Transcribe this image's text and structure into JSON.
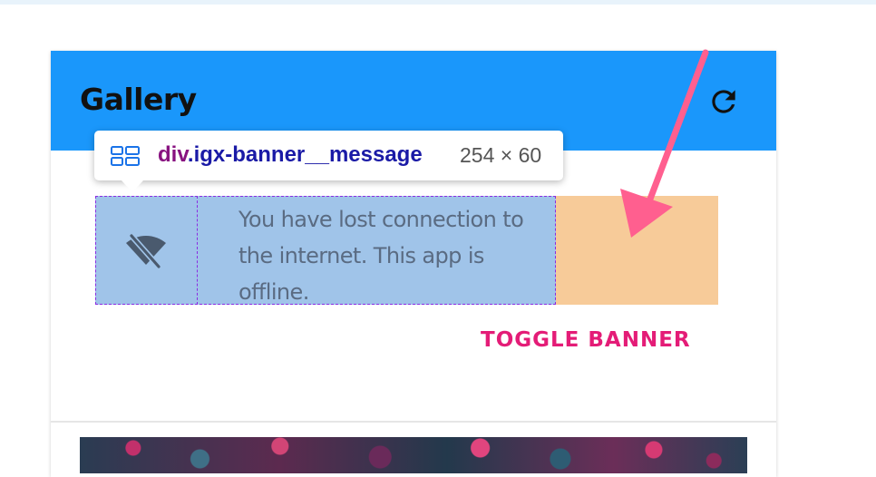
{
  "card": {
    "title": "Gallery",
    "refresh_icon": "refresh-icon",
    "header_color": "#1a97fb"
  },
  "banner": {
    "icon": "wifi-off-icon",
    "message": "You have lost connection to the internet. This app is offline."
  },
  "actions": {
    "toggle_label": "TOGGLE BANNER",
    "toggle_color": "#e41c77"
  },
  "devtools_tooltip": {
    "icon": "flex-layout-icon",
    "tag": "div",
    "class_name": ".igx-banner__message",
    "dimensions": "254 × 60"
  },
  "annotation": {
    "arrow_color": "#ff5f8f"
  }
}
